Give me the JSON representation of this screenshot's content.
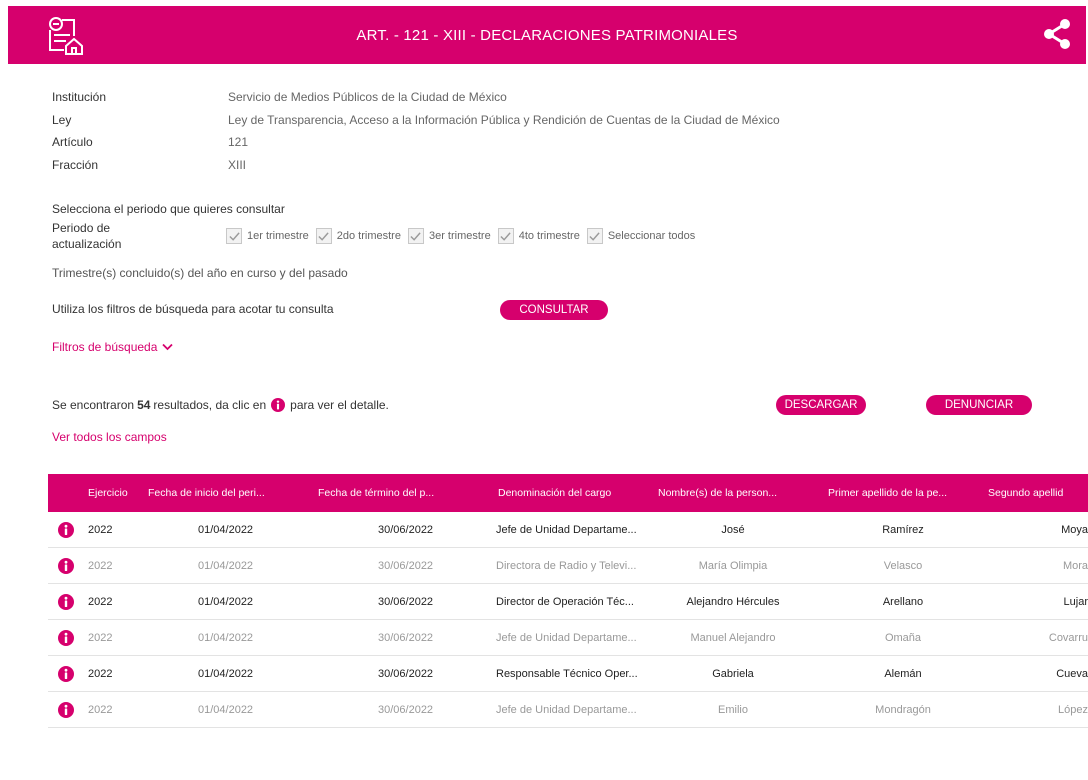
{
  "header": {
    "title": "ART. - 121 - XIII - DECLARACIONES PATRIMONIALES",
    "logo_icon": "document-home-icon",
    "share_icon": "share-icon",
    "color": "#d6006d"
  },
  "meta": [
    {
      "key": "Institución",
      "value": "Servicio de Medios Públicos de la Ciudad de México"
    },
    {
      "key": "Ley",
      "value": "Ley de Transparencia, Acceso a la Información Pública y Rendición de Cuentas de la Ciudad de México"
    },
    {
      "key": "Artículo",
      "value": "121"
    },
    {
      "key": "Fracción",
      "value": "XIII"
    }
  ],
  "period": {
    "prompt": "Selecciona el periodo que quieres consultar",
    "label_line1": "Periodo de",
    "label_line2": "actualización",
    "options": [
      {
        "label": "1er trimestre",
        "checked": true
      },
      {
        "label": "2do trimestre",
        "checked": true
      },
      {
        "label": "3er trimestre",
        "checked": true
      },
      {
        "label": "4to trimestre",
        "checked": true
      },
      {
        "label": "Seleccionar todos",
        "checked": true
      }
    ],
    "note": "Trimestre(s) concluido(s) del año en curso y del pasado"
  },
  "filters": {
    "note": "Utiliza los filtros de búsqueda para acotar tu consulta",
    "consultar_label": "CONSULTAR",
    "toggle_label": "Filtros de búsqueda"
  },
  "results": {
    "prefix": "Se encontraron",
    "count": "54",
    "middle": "resultados, da clic en",
    "suffix": "para ver el detalle.",
    "descargar_label": "DESCARGAR",
    "denunciar_label": "DENUNCIAR",
    "ver_todos_label": "Ver todos los campos"
  },
  "table": {
    "headers": [
      "Ejercicio",
      "Fecha de inicio del peri...",
      "Fecha de término del p...",
      "Denominación del cargo",
      "Nombre(s) de la person...",
      "Primer apellido de la pe...",
      "Segundo apellid"
    ],
    "rows": [
      [
        "2022",
        "01/04/2022",
        "30/06/2022",
        "Jefe de Unidad Departame...",
        "José",
        "Ramírez",
        "Moya"
      ],
      [
        "2022",
        "01/04/2022",
        "30/06/2022",
        "Directora de Radio y Televi...",
        "María Olimpia",
        "Velasco",
        "Mora"
      ],
      [
        "2022",
        "01/04/2022",
        "30/06/2022",
        "Director de Operación Téc...",
        "Alejandro Hércules",
        "Arellano",
        "Lujar"
      ],
      [
        "2022",
        "01/04/2022",
        "30/06/2022",
        "Jefe de Unidad Departame...",
        "Manuel Alejandro",
        "Omaña",
        "Covarru"
      ],
      [
        "2022",
        "01/04/2022",
        "30/06/2022",
        "Responsable Técnico Oper...",
        "Gabriela",
        "Alemán",
        "Cueva"
      ],
      [
        "2022",
        "01/04/2022",
        "30/06/2022",
        "Jefe de Unidad Departame...",
        "Emilio",
        "Mondragón",
        "López"
      ]
    ]
  }
}
